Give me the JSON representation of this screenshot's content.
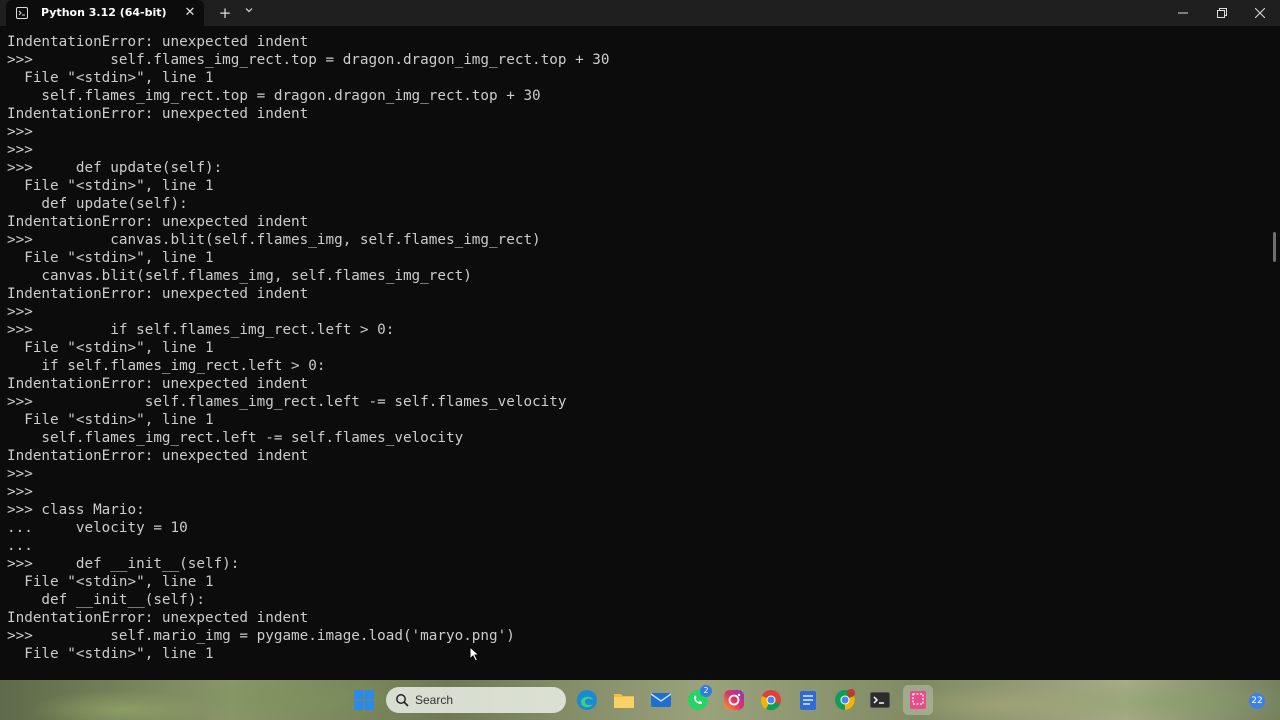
{
  "window": {
    "tab_title": "Python 3.12 (64-bit)",
    "tab_close_glyph": "✕",
    "new_tab_glyph": "+",
    "dropdown_glyph": "⌵"
  },
  "terminal": {
    "lines": [
      "IndentationError: unexpected indent",
      ">>>         self.flames_img_rect.top = dragon.dragon_img_rect.top + 30",
      "  File \"<stdin>\", line 1",
      "    self.flames_img_rect.top = dragon.dragon_img_rect.top + 30",
      "IndentationError: unexpected indent",
      ">>>",
      ">>>",
      ">>>     def update(self):",
      "  File \"<stdin>\", line 1",
      "    def update(self):",
      "IndentationError: unexpected indent",
      ">>>         canvas.blit(self.flames_img, self.flames_img_rect)",
      "  File \"<stdin>\", line 1",
      "    canvas.blit(self.flames_img, self.flames_img_rect)",
      "IndentationError: unexpected indent",
      ">>>",
      ">>>         if self.flames_img_rect.left > 0:",
      "  File \"<stdin>\", line 1",
      "    if self.flames_img_rect.left > 0:",
      "IndentationError: unexpected indent",
      ">>>             self.flames_img_rect.left -= self.flames_velocity",
      "  File \"<stdin>\", line 1",
      "    self.flames_img_rect.left -= self.flames_velocity",
      "IndentationError: unexpected indent",
      ">>>",
      ">>>",
      ">>> class Mario:",
      "...     velocity = 10",
      "...",
      ">>>     def __init__(self):",
      "  File \"<stdin>\", line 1",
      "    def __init__(self):",
      "IndentationError: unexpected indent",
      ">>>         self.mario_img = pygame.image.load('maryo.png')",
      "  File \"<stdin>\", line 1"
    ]
  },
  "taskbar": {
    "search_placeholder": "Search",
    "mail_badge": "2",
    "notification_count": "22",
    "icons": [
      "start-icon",
      "edge-icon",
      "file-explorer-icon",
      "mail-icon",
      "whatsapp-icon",
      "instagram-icon",
      "chrome-icon",
      "notepad-icon",
      "chrome-profile-icon",
      "terminal-icon",
      "snipping-tool-icon"
    ]
  },
  "colors": {
    "terminal_bg": "#0c0c0c",
    "terminal_fg": "#cccccc",
    "titlebar_bg": "#1f1f1f"
  }
}
